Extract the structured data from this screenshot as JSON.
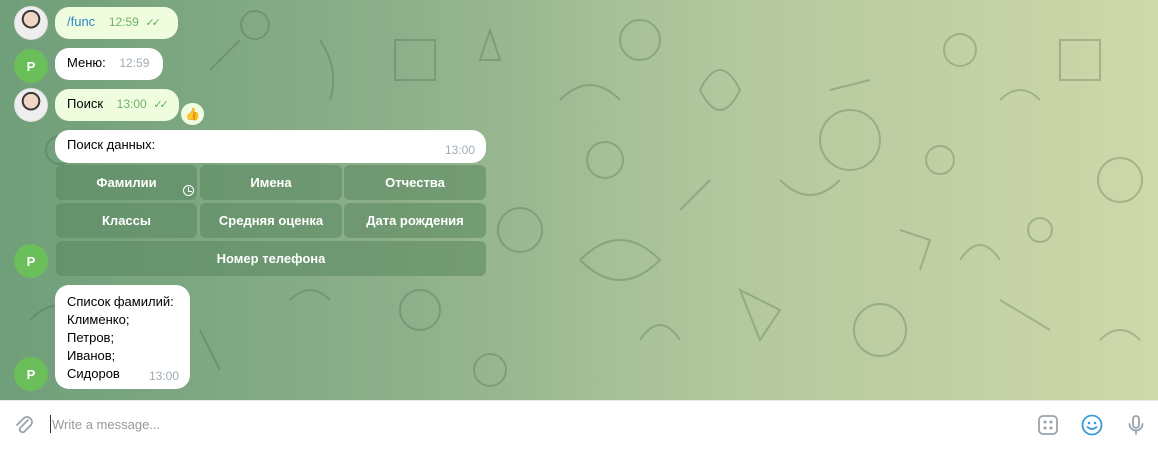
{
  "messages": [
    {
      "avatar": "",
      "text": "/func",
      "time": "12:59",
      "checks": "✓✓"
    },
    {
      "avatar": "P",
      "text": "Меню:",
      "time": "12:59"
    },
    {
      "avatar": "",
      "text": "Поиск",
      "time": "13:00",
      "checks": "✓✓",
      "reaction": "👍"
    },
    {
      "text": "Поиск данных:",
      "time": "13:00"
    },
    {
      "avatar": "P",
      "lines": [
        "Список фамилий:",
        "Клименко;",
        "Петров;",
        "Иванов;",
        "Сидоров"
      ],
      "time": "13:00"
    }
  ],
  "keyboard": [
    [
      "Фамилии",
      "Имена",
      "Отчества"
    ],
    [
      "Классы",
      "Средняя оценка",
      "Дата рождения"
    ],
    [
      "Номер телефона"
    ]
  ],
  "composer": {
    "placeholder": "Write a message..."
  },
  "icons": {
    "attach": "paperclip-icon",
    "commands": "bot-commands-icon",
    "emoji": "emoji-icon",
    "mic": "microphone-icon",
    "pending": "clock-icon"
  },
  "colors": {
    "outgoing_bubble": "#effdde",
    "incoming_bubble": "#ffffff",
    "avatar_bg": "#6bbf5a",
    "link": "#2f89c7"
  }
}
